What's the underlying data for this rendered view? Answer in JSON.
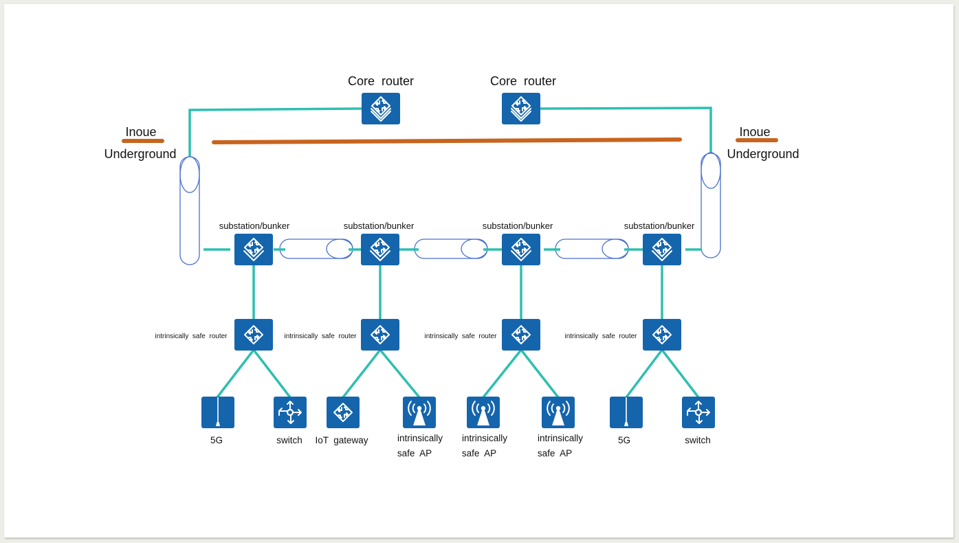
{
  "diagram": {
    "title_nodes": {
      "core_router_left": "Core  router",
      "core_router_right": "Core  router"
    },
    "zones": {
      "left": {
        "above": "Inoue",
        "below": "Underground"
      },
      "right": {
        "above": "Inoue",
        "below": "Underground"
      }
    },
    "substations": [
      {
        "label": "substation/bunker"
      },
      {
        "label": "substation/bunker"
      },
      {
        "label": "substation/bunker"
      },
      {
        "label": "substation/bunker"
      }
    ],
    "routers": [
      {
        "label": "intrinsically  safe  router"
      },
      {
        "label": "intrinsically  safe  router"
      },
      {
        "label": "intrinsically  safe  router"
      },
      {
        "label": "intrinsically  safe  router"
      }
    ],
    "endpoints": [
      {
        "icon": "antenna-5g-icon",
        "line1": "5G",
        "line2": ""
      },
      {
        "icon": "switch-icon",
        "line1": "switch",
        "line2": ""
      },
      {
        "icon": "iot-gateway-icon",
        "line1": "IoT  gateway",
        "line2": ""
      },
      {
        "icon": "wireless-ap-icon",
        "line1": "intrinsically",
        "line2": "safe  AP"
      },
      {
        "icon": "wireless-ap-icon",
        "line1": "intrinsically",
        "line2": "safe  AP"
      },
      {
        "icon": "wireless-ap-icon",
        "line1": "intrinsically",
        "line2": "safe  AP"
      },
      {
        "icon": "antenna-5g-icon",
        "line1": "5G",
        "line2": ""
      },
      {
        "icon": "switch-icon",
        "line1": "switch",
        "line2": ""
      }
    ],
    "colors": {
      "link": "#2ebfb0",
      "device_tile": "#1565ad",
      "tunnel_outline": "#4a6fd0",
      "surface_line": "#c8641e"
    }
  }
}
